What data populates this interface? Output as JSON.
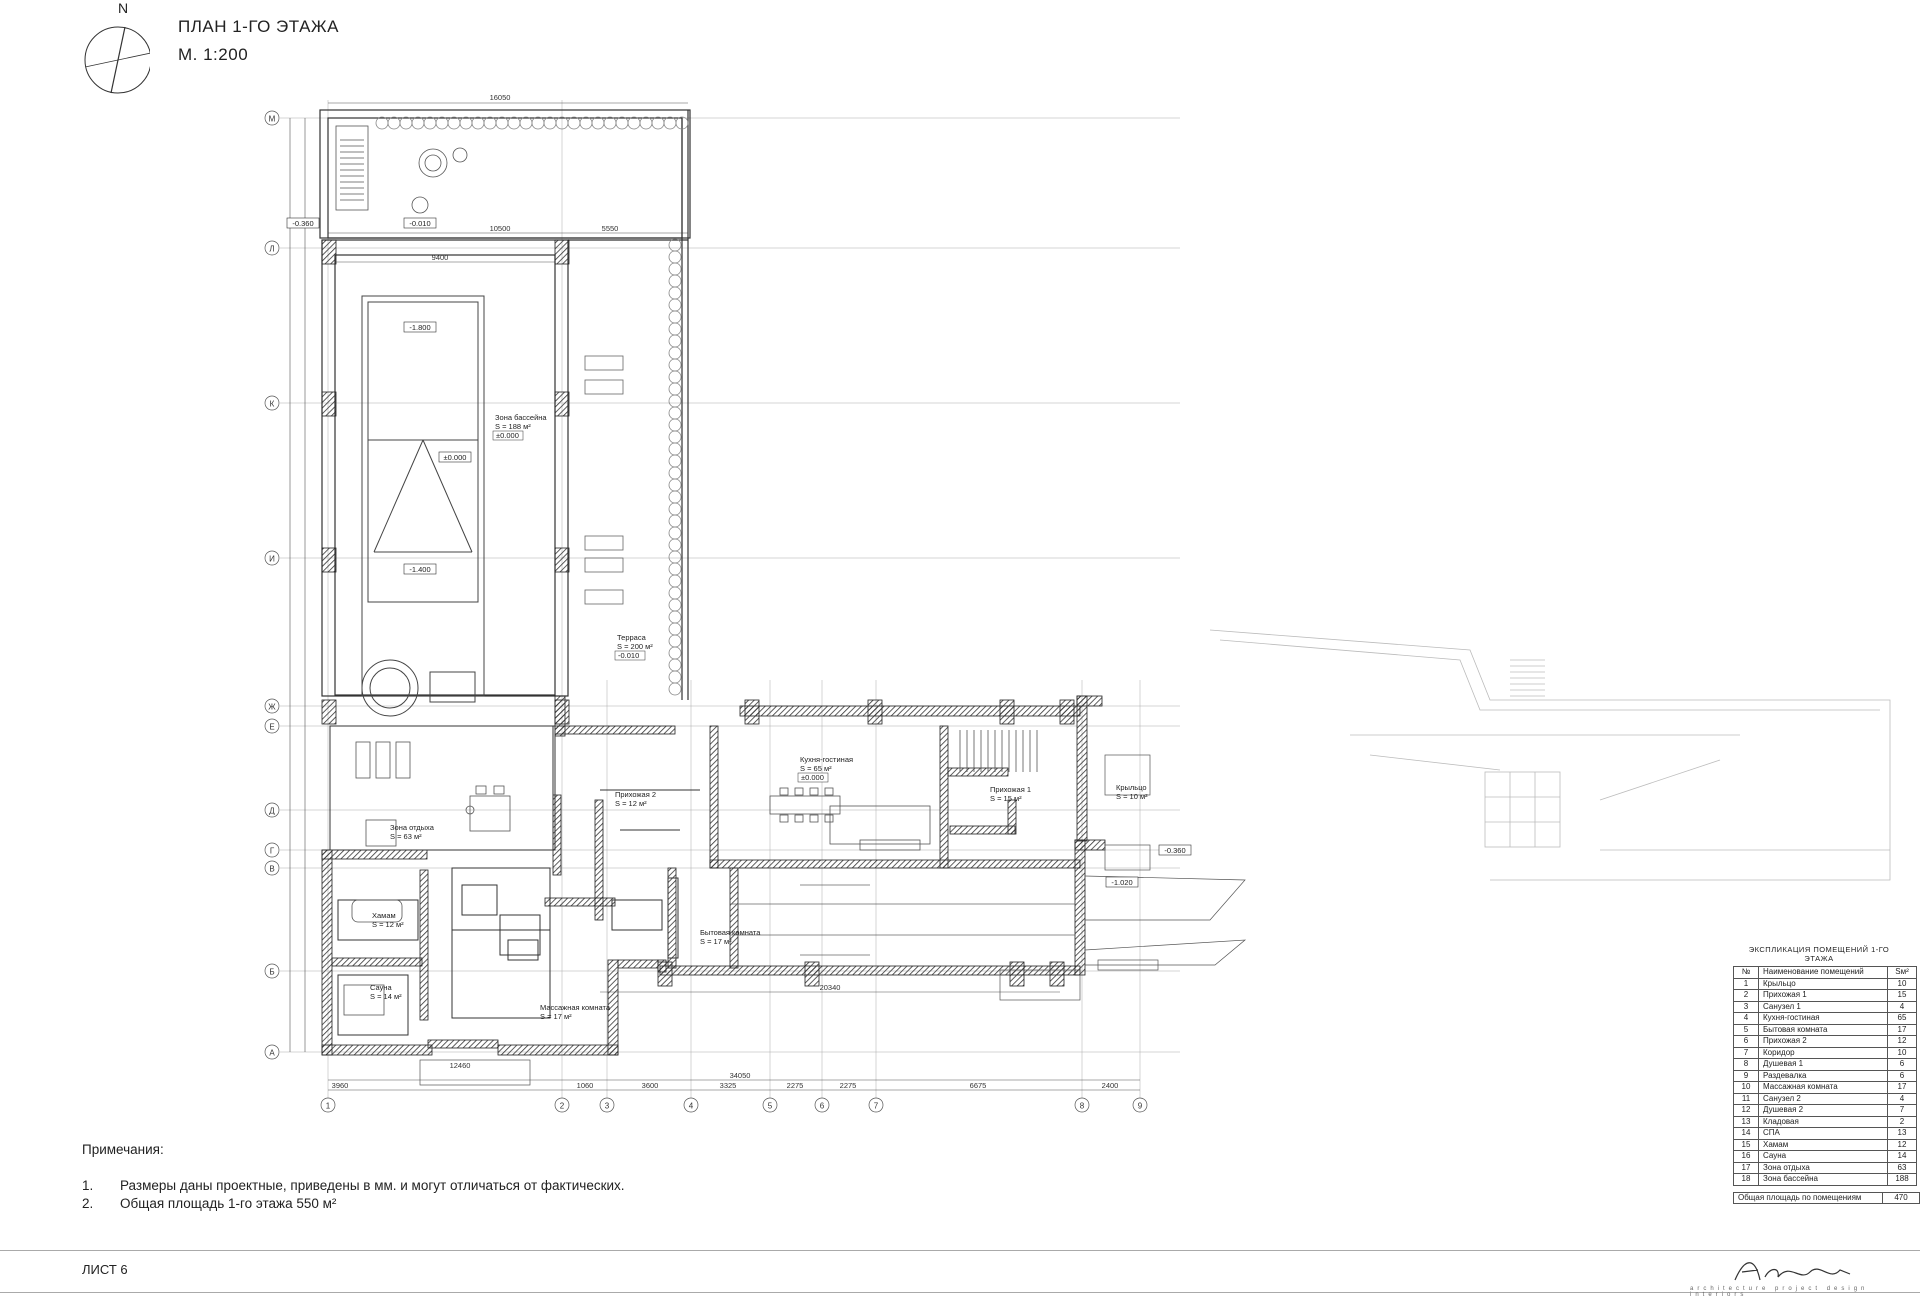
{
  "header": {
    "north": "N",
    "title": "ПЛАН 1-ГО ЭТАЖА",
    "scale": "М. 1:200"
  },
  "plan": {
    "axes_letters": [
      "М",
      "Л",
      "К",
      "И",
      "Ж",
      "Е",
      "Д",
      "Г",
      "В",
      "Б",
      "А"
    ],
    "axes_numbers": [
      "1",
      "2",
      "3",
      "4",
      "5",
      "6",
      "7",
      "8",
      "9"
    ],
    "dims_top": [
      "16050",
      "10500",
      "5550",
      "9400"
    ],
    "dims_bottom": [
      "3960",
      "1060",
      "3600",
      "3325",
      "2275",
      "2275",
      "6675",
      "2400"
    ],
    "dims_bottom_total": "34050",
    "dim_bottom_2": "20340",
    "dim_bottom_3": "12460",
    "rooms": [
      {
        "name": "Зона бассейна",
        "area": "S = 188 м²",
        "level": "±0.000"
      },
      {
        "name": "Терраса",
        "area": "S = 200 м²",
        "level": "-0.010"
      },
      {
        "name": "Кухня-гостиная",
        "area": "S = 65 м²",
        "level": "±0.000"
      },
      {
        "name": "Зона отдыха",
        "area": "S = 63 м²"
      },
      {
        "name": "Хамам",
        "area": "S = 12 м²"
      },
      {
        "name": "Сауна",
        "area": "S = 14 м²"
      },
      {
        "name": "Массажная комната",
        "area": "S = 17 м²"
      },
      {
        "name": "Бытовая комната",
        "area": "S = 17 м²"
      },
      {
        "name": "Прихожая 1",
        "area": "S = 15 м²"
      },
      {
        "name": "Крыльцо",
        "area": "S = 10 м²"
      },
      {
        "name": "Прихожая 2",
        "area": "S = 12 м²"
      }
    ],
    "levels": [
      "-1.800",
      "-1.400",
      "-0.360",
      "-0.010",
      "±0.000",
      "-1.020",
      "-0.360"
    ]
  },
  "notes": {
    "heading": "Примечания:",
    "items": [
      {
        "num": "1.",
        "text": "Размеры даны проектные, приведены в мм. и могут отличаться от фактических."
      },
      {
        "num": "2.",
        "text": "Общая площадь 1-го этажа 550 м²"
      }
    ]
  },
  "explication": {
    "title": "ЭКСПЛИКАЦИЯ ПОМЕЩЕНИЙ 1-ГО ЭТАЖА",
    "headers": [
      "№",
      "Наименование помещений",
      "Sм²"
    ],
    "rows": [
      [
        "1",
        "Крыльцо",
        "10"
      ],
      [
        "2",
        "Прихожая 1",
        "15"
      ],
      [
        "3",
        "Санузел 1",
        "4"
      ],
      [
        "4",
        "Кухня-гостиная",
        "65"
      ],
      [
        "5",
        "Бытовая комната",
        "17"
      ],
      [
        "6",
        "Прихожая 2",
        "12"
      ],
      [
        "7",
        "Коридор",
        "10"
      ],
      [
        "8",
        "Душевая 1",
        "6"
      ],
      [
        "9",
        "Раздевалка",
        "6"
      ],
      [
        "10",
        "Массажная комната",
        "17"
      ],
      [
        "11",
        "Санузел 2",
        "4"
      ],
      [
        "12",
        "Душевая 2",
        "7"
      ],
      [
        "13",
        "Кладовая",
        "2"
      ],
      [
        "14",
        "СПА",
        "13"
      ],
      [
        "15",
        "Хамам",
        "12"
      ],
      [
        "16",
        "Сауна",
        "14"
      ],
      [
        "17",
        "Зона отдыха",
        "63"
      ],
      [
        "18",
        "Зона бассейна",
        "188"
      ]
    ],
    "total_label": "Общая площадь по помещениям",
    "total_value": "470"
  },
  "footer": {
    "sheet": "ЛИСТ 6",
    "brand": "Archigraph",
    "brand_sub": "architecture  project  design  interiors"
  }
}
